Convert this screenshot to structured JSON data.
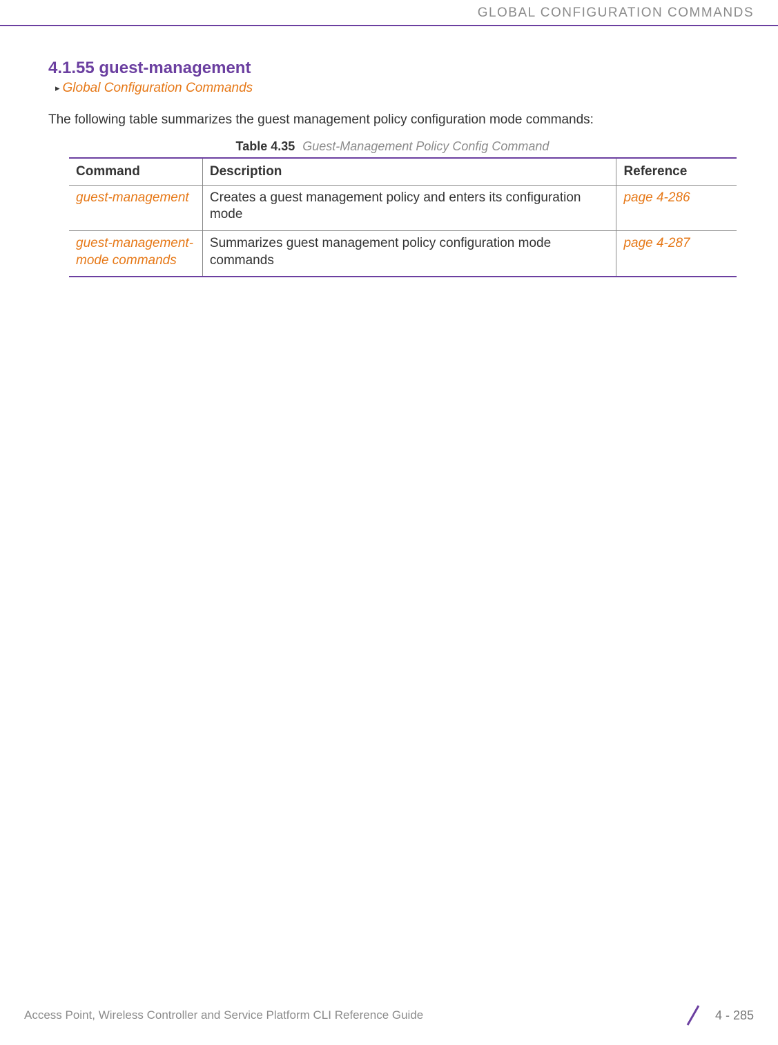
{
  "header": {
    "text": "GLOBAL CONFIGURATION COMMANDS"
  },
  "section": {
    "number_title": "4.1.55 guest-management",
    "breadcrumb": "Global Configuration Commands",
    "intro": "The following table summarizes the guest management policy configuration mode commands:"
  },
  "table": {
    "label": "Table 4.35",
    "title": "Guest-Management Policy Config Command",
    "headers": {
      "command": "Command",
      "description": "Description",
      "reference": "Reference"
    },
    "rows": [
      {
        "command": "guest-management",
        "description": "Creates a guest management policy and enters its configuration mode",
        "reference": "page 4-286"
      },
      {
        "command": "guest-management-mode commands",
        "description": "Summarizes guest management policy configuration mode commands",
        "reference": "page 4-287"
      }
    ]
  },
  "footer": {
    "text": "Access Point, Wireless Controller and Service Platform CLI Reference Guide",
    "page": "4 - 285"
  }
}
